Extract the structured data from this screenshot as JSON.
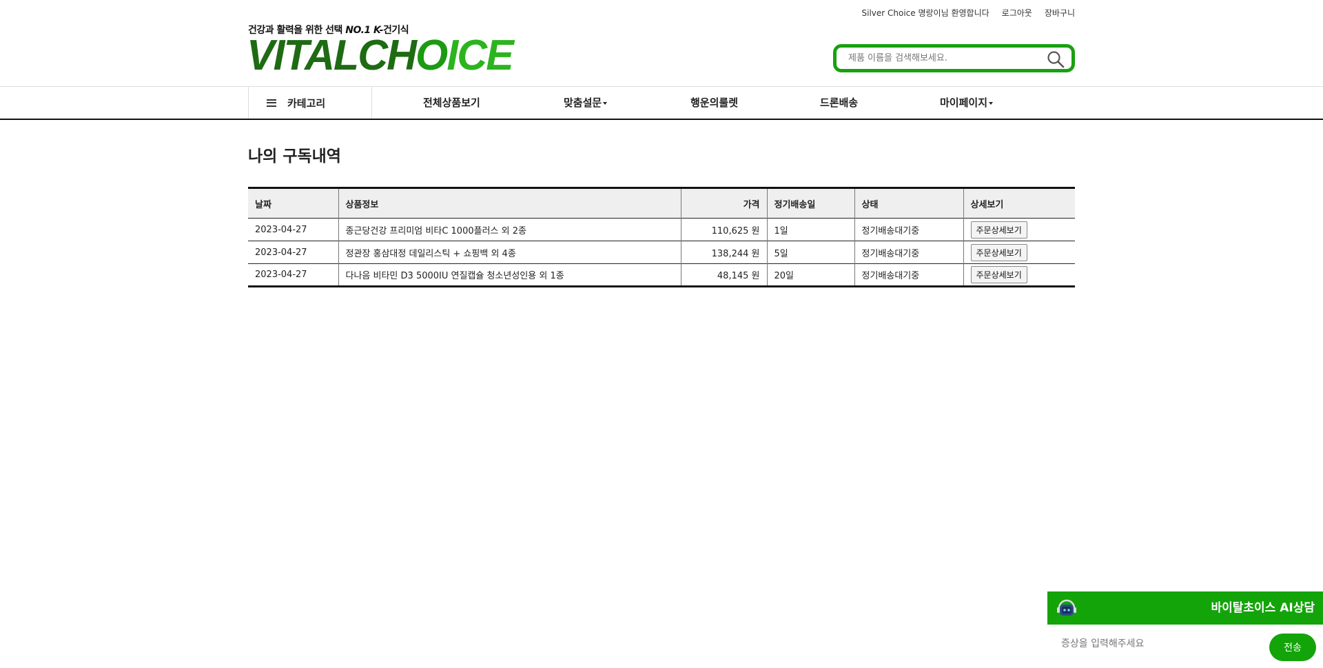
{
  "header": {
    "welcome": "Silver Choice 명랑이님 환영합니다",
    "logout": "로그아웃",
    "cart": "장바구니",
    "tagline_prefix": "건강과 활력을 위한 선택 ",
    "tagline_emph": "NO.1 K-",
    "tagline_suffix": "건기식",
    "logo_part1": "VITALCH",
    "logo_part2": "O",
    "logo_part3": "ICE",
    "search_placeholder": "제품 이름을 검색해보세요."
  },
  "nav": {
    "category": "카테고리",
    "items": [
      "전체상품보기",
      "맞춤설문",
      "행운의룰렛",
      "드론배송",
      "마이페이지"
    ]
  },
  "page": {
    "title": "나의 구독내역"
  },
  "table": {
    "headers": [
      "날짜",
      "상품정보",
      "가격",
      "정기배송일",
      "상태",
      "상세보기"
    ],
    "rows": [
      {
        "date": "2023-04-27",
        "product": "종근당건강 프리미엄 비타C 1000플러스 외 2종",
        "price": "110,625 원",
        "day": "1일",
        "status": "정기배송대기중",
        "detail": "주문상세보기"
      },
      {
        "date": "2023-04-27",
        "product": "정관장 홍삼대정 데일리스틱 + 쇼핑백 외 4종",
        "price": "138,244 원",
        "day": "5일",
        "status": "정기배송대기중",
        "detail": "주문상세보기"
      },
      {
        "date": "2023-04-27",
        "product": "다나음 비타민 D3 5000IU 연질캡슐 청소년성인용 외 1종",
        "price": "48,145 원",
        "day": "20일",
        "status": "정기배송대기중",
        "detail": "주문상세보기"
      }
    ]
  },
  "chat": {
    "title": "바이탈초이스 AI상담",
    "placeholder": "증상을 입력해주세요",
    "send": "전송"
  },
  "colors": {
    "brand_green": "#13a40a",
    "logo_dark": "#1e6b14"
  }
}
